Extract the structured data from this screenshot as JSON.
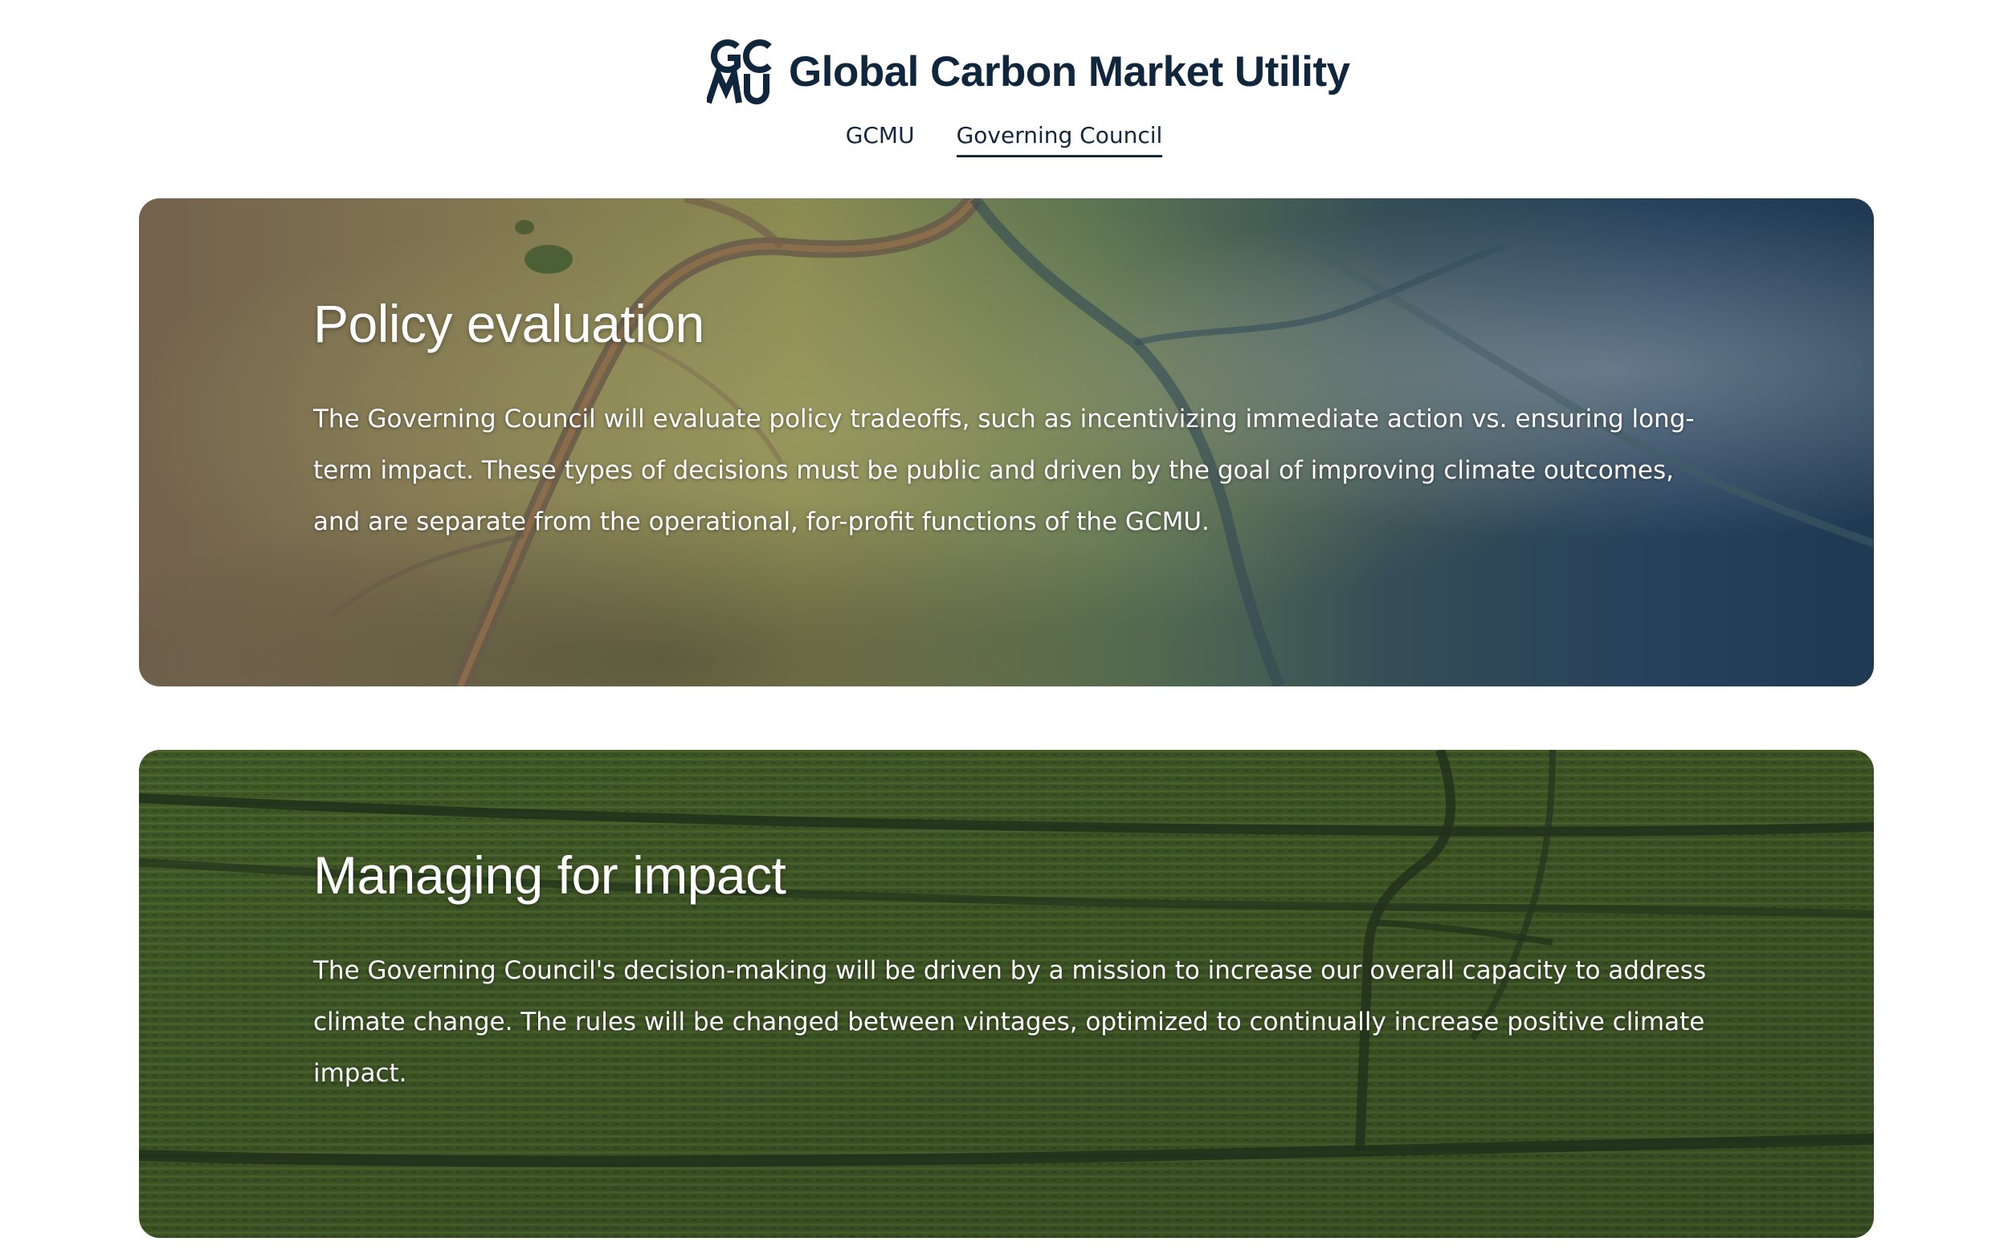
{
  "colors": {
    "brand_navy": "#10263d",
    "text_on_image": "#ffffff",
    "background": "#ffffff"
  },
  "header": {
    "logo_icon": "gcmu-logo-icon",
    "logo_letters": "GCMU",
    "title": "Global Carbon Market Utility"
  },
  "nav": {
    "items": [
      {
        "label": "GCMU",
        "active": false
      },
      {
        "label": "Governing Council",
        "active": true
      }
    ]
  },
  "sections": [
    {
      "title": "Policy evaluation",
      "body": "The Governing Council will evaluate policy tradeoffs, such as incentivizing immediate action vs. ensuring long-term impact. These types of decisions must be public and driven by the goal of improving climate outcomes, and are separate from the operational, for-profit functions of the GCMU.",
      "background": "aerial-river-delta-image"
    },
    {
      "title": "Managing for impact",
      "body": "The Governing Council's decision-making will be driven by a mission to increase our overall capacity to address climate change. The rules will be changed between vintages, optimized to continually increase positive climate impact.",
      "background": "aerial-crop-field-image"
    }
  ]
}
